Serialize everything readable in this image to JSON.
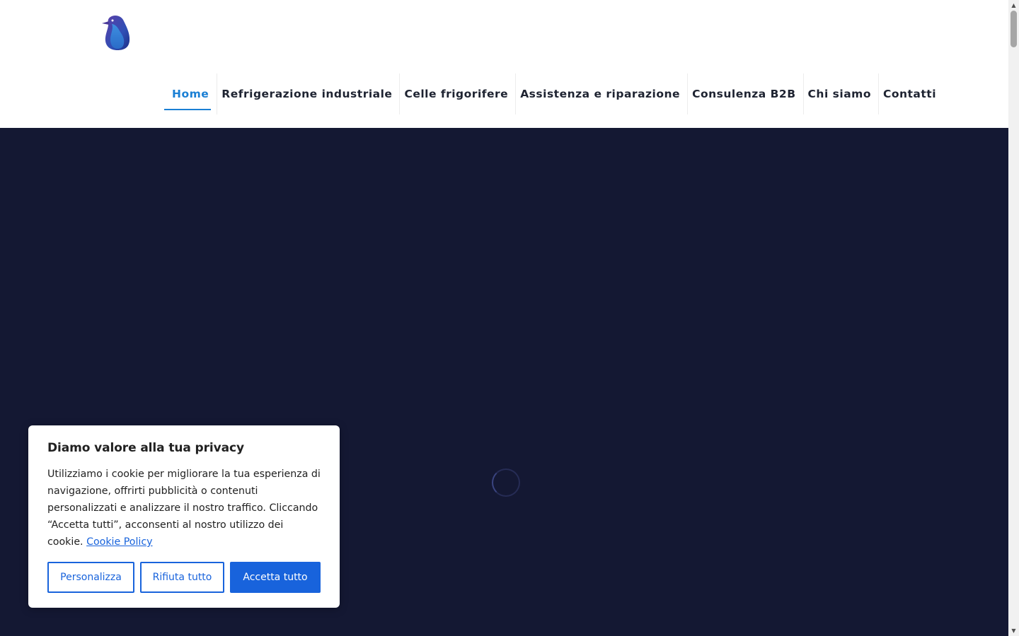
{
  "header": {
    "logo_icon": "penguin-logo-icon",
    "nav": [
      {
        "label": "Home",
        "active": true
      },
      {
        "label": "Refrigerazione industriale",
        "active": false
      },
      {
        "label": "Celle frigorifere",
        "active": false
      },
      {
        "label": "Assistenza e riparazione",
        "active": false
      },
      {
        "label": "Consulenza B2B",
        "active": false
      },
      {
        "label": "Chi siamo",
        "active": false
      },
      {
        "label": "Contatti",
        "active": false
      }
    ]
  },
  "hero": {
    "background_color": "#141833",
    "loading_icon": "loading-spinner-icon"
  },
  "cookie_banner": {
    "title": "Diamo valore alla tua privacy",
    "body": "Utilizziamo i cookie per migliorare la tua esperienza di navigazione, offrirti pubblicità o contenuti personalizzati e analizzare il nostro traffico. Cliccando “Accetta tutti”, acconsenti al nostro utilizzo dei cookie.",
    "link_label": "Cookie Policy",
    "buttons": {
      "customize": "Personalizza",
      "reject": "Rifiuta tutto",
      "accept": "Accetta tutto"
    },
    "accent_color": "#1863dc"
  },
  "colors": {
    "nav_active": "#1a7fd4",
    "nav_text": "#1e2331"
  }
}
